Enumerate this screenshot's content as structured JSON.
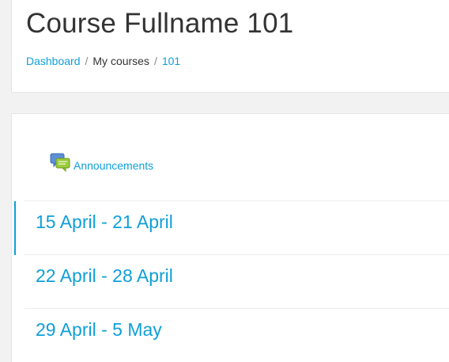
{
  "page": {
    "title": "Course Fullname 101"
  },
  "breadcrumb": {
    "items": [
      {
        "label": "Dashboard",
        "link": true
      },
      {
        "label": "My courses",
        "link": false
      },
      {
        "label": "101",
        "link": true
      }
    ],
    "separator": "/"
  },
  "activity": {
    "icon": "forum-icon",
    "label": "Announcements"
  },
  "sections": [
    {
      "title": "15 April - 21 April",
      "current": true
    },
    {
      "title": "22 April - 28 April",
      "current": false
    },
    {
      "title": "29 April - 5 May",
      "current": false
    }
  ],
  "colors": {
    "accent": "#0f9fd8",
    "background": "#f2f2f2",
    "text": "#333333"
  }
}
